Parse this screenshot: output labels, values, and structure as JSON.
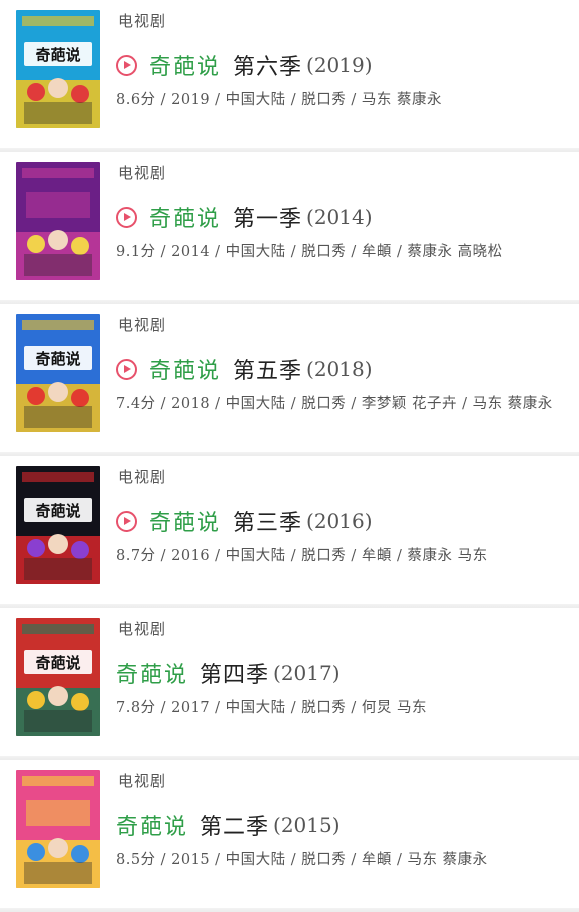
{
  "items": [
    {
      "category": "电视剧",
      "show_name": "奇葩说",
      "season": "第六季",
      "year": "(2019)",
      "meta": "8.6分 / 2019 / 中国大陆 / 脱口秀 / 马东 蔡康永",
      "has_play": true,
      "poster_text": "奇葩说",
      "poster_colors": [
        "#1da1d8",
        "#f6c61c",
        "#e03b3b"
      ]
    },
    {
      "category": "电视剧",
      "show_name": "奇葩说",
      "season": "第一季",
      "year": "(2014)",
      "meta": "9.1分 / 2014 / 中国大陆 / 脱口秀 / 牟頔 / 蔡康永 高晓松",
      "has_play": true,
      "poster_text": "",
      "poster_colors": [
        "#6b1f86",
        "#c23a9a",
        "#f2d24b"
      ]
    },
    {
      "category": "电视剧",
      "show_name": "奇葩说",
      "season": "第五季",
      "year": "(2018)",
      "meta": "7.4分 / 2018 / 中国大陆 / 脱口秀 / 李梦颖 花子卉 / 马东 蔡康永",
      "has_play": true,
      "poster_text": "奇葩说",
      "poster_colors": [
        "#2c6fd6",
        "#f4c21f",
        "#e23a30"
      ]
    },
    {
      "category": "电视剧",
      "show_name": "奇葩说",
      "season": "第三季",
      "year": "(2016)",
      "meta": "8.7分 / 2016 / 中国大陆 / 脱口秀 / 牟頔 / 蔡康永 马东",
      "has_play": true,
      "poster_text": "奇葩说",
      "poster_colors": [
        "#12121a",
        "#d7262b",
        "#8a3fd0"
      ]
    },
    {
      "category": "电视剧",
      "show_name": "奇葩说",
      "season": "第四季",
      "year": "(2017)",
      "meta": "7.8分 / 2017 / 中国大陆 / 脱口秀 / 何炅 马东",
      "has_play": false,
      "poster_text": "奇葩说",
      "poster_colors": [
        "#c9302c",
        "#1f7a5a",
        "#f1c232"
      ]
    },
    {
      "category": "电视剧",
      "show_name": "奇葩说",
      "season": "第二季",
      "year": "(2015)",
      "meta": "8.5分 / 2015 / 中国大陆 / 脱口秀 / 牟頔 / 马东 蔡康永",
      "has_play": false,
      "poster_text": "",
      "poster_colors": [
        "#e84b8a",
        "#f6d23a",
        "#3b8fe0"
      ]
    }
  ]
}
